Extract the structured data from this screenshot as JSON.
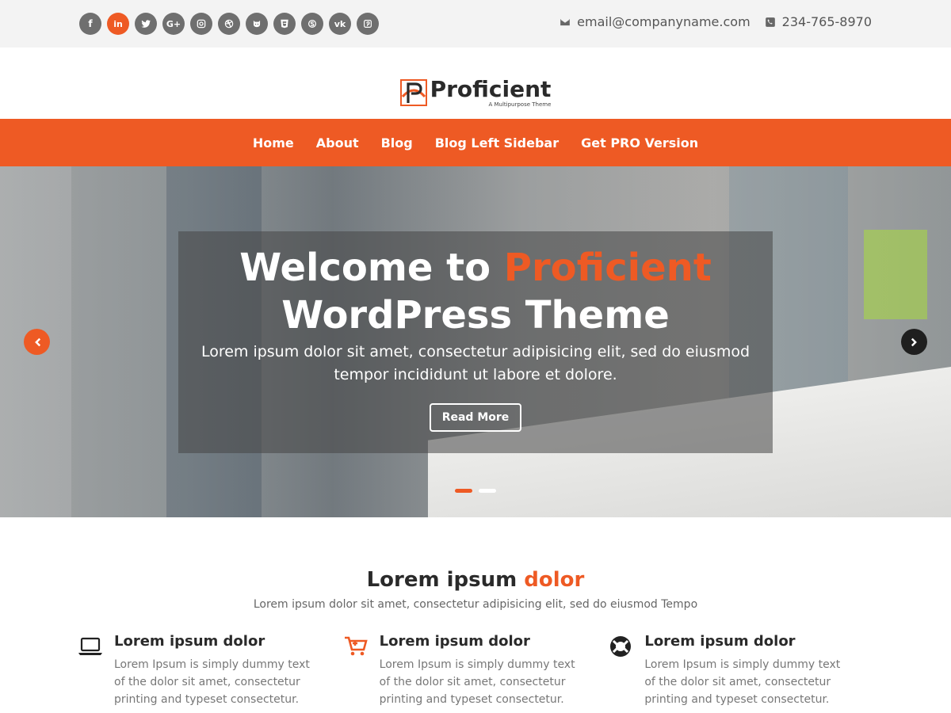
{
  "colors": {
    "accent": "#ee5a24",
    "nav_bg": "#ee5a24",
    "topbar_bg": "#f3f3f3"
  },
  "topbar": {
    "social": [
      {
        "name": "facebook-icon",
        "glyph": "f"
      },
      {
        "name": "linkedin-icon",
        "glyph": "in"
      },
      {
        "name": "twitter-icon",
        "glyph": ""
      },
      {
        "name": "google-plus-icon",
        "glyph": "G+"
      },
      {
        "name": "instagram-icon",
        "glyph": ""
      },
      {
        "name": "dribbble-icon",
        "glyph": ""
      },
      {
        "name": "github-icon",
        "glyph": ""
      },
      {
        "name": "html5-icon",
        "glyph": ""
      },
      {
        "name": "skype-icon",
        "glyph": ""
      },
      {
        "name": "vk-icon",
        "glyph": "vk"
      },
      {
        "name": "pinterest-icon",
        "glyph": ""
      }
    ],
    "email": "email@companyname.com",
    "phone": "234-765-8970"
  },
  "logo": {
    "name": "Proficient",
    "tagline": "A Multipurpose Theme"
  },
  "nav": {
    "items": [
      "Home",
      "About",
      "Blog",
      "Blog Left Sidebar",
      "Get PRO Version"
    ]
  },
  "hero": {
    "title_prefix": "Welcome to ",
    "title_accent": "Proficient",
    "title_line2": "WordPress Theme",
    "subtitle": "Lorem ipsum dolor sit amet, consectetur adipisicing elit, sed do eiusmod tempor incididunt ut labore et dolore.",
    "button": "Read More",
    "active_slide": 1,
    "slide_count": 2
  },
  "section": {
    "title_prefix": "Lorem ipsum ",
    "title_accent": "dolor",
    "subtitle": "Lorem ipsum dolor sit amet, consectetur adipisicing elit, sed do eiusmod Tempo"
  },
  "features": [
    {
      "icon": "laptop-icon",
      "title": "Lorem ipsum  dolor",
      "text": "Lorem Ipsum is simply dummy text of the dolor sit amet, consectetur printing and typeset consectetur."
    },
    {
      "icon": "cart-icon",
      "title": "Lorem ipsum  dolor",
      "text": "Lorem Ipsum is simply dummy text of the dolor sit amet, consectetur printing and typeset consectetur."
    },
    {
      "icon": "lifebuoy-icon",
      "title": "Lorem ipsum  dolor",
      "text": "Lorem Ipsum is simply dummy text of the dolor sit amet, consectetur printing and typeset consectetur."
    }
  ]
}
